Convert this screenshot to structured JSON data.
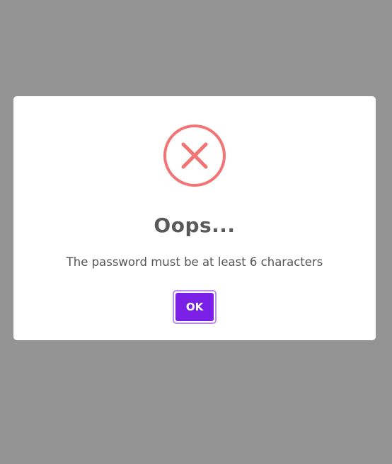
{
  "dialog": {
    "icon": "error-x-icon",
    "title": "Oops...",
    "message": "The password must be at least 6 characters",
    "ok_label": "OK"
  },
  "colors": {
    "backdrop": "#949494",
    "error_red": "#f27474",
    "button_purple": "#7a1fe6",
    "button_focus_ring": "#b98cf0",
    "title_text": "#595959",
    "message_text": "#545454"
  }
}
